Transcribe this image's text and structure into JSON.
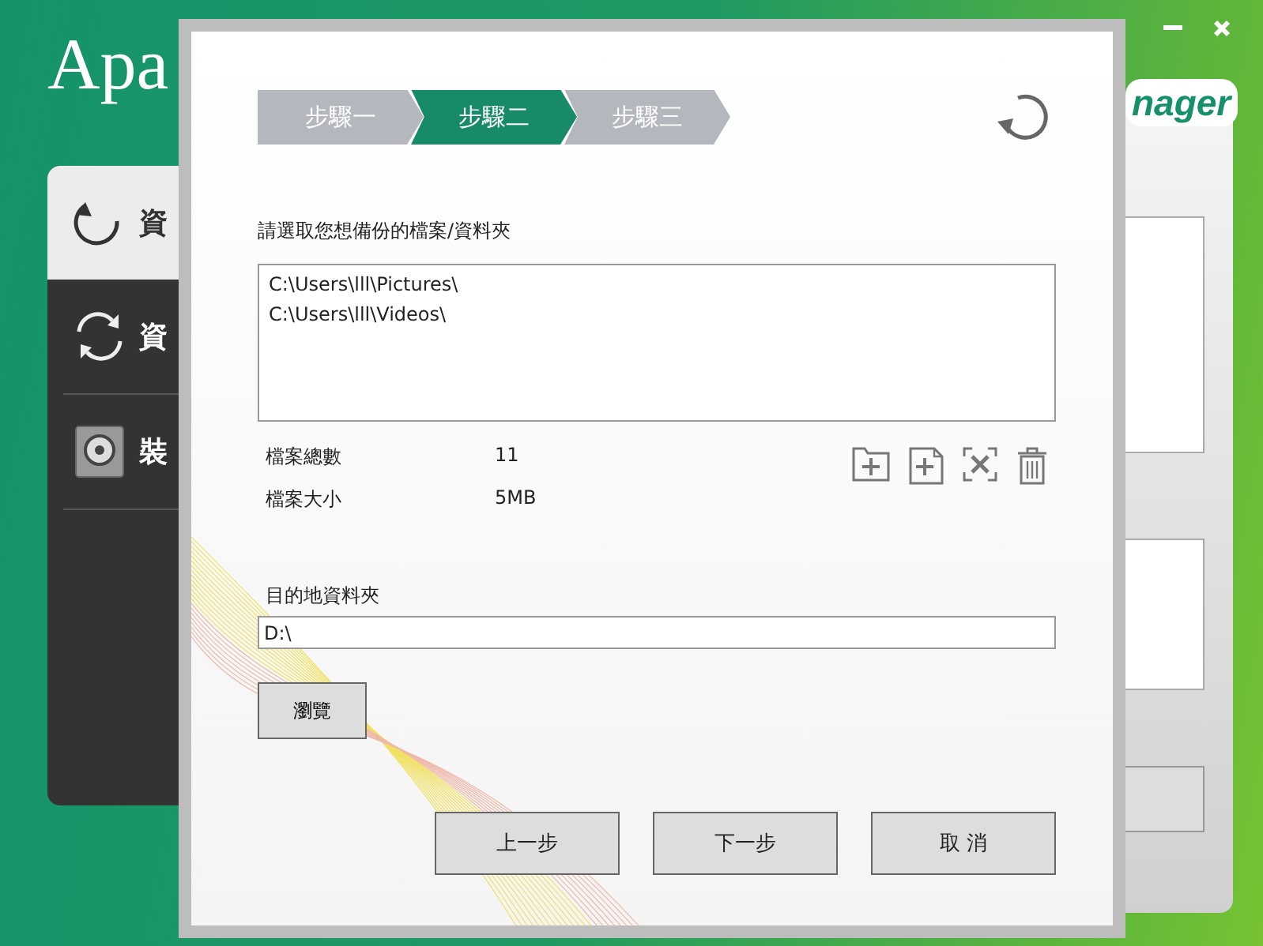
{
  "app": {
    "logo": "Apa",
    "logo_tail": "nager",
    "sidebar": [
      {
        "label": "資",
        "kind": "restore",
        "selected": true
      },
      {
        "label": "資",
        "kind": "sync",
        "selected": false
      },
      {
        "label": "裝",
        "kind": "drive",
        "selected": false
      }
    ]
  },
  "dialog": {
    "steps": [
      {
        "label": "步驟一",
        "selected": false
      },
      {
        "label": "步驟二",
        "selected": true
      },
      {
        "label": "步驟三",
        "selected": false
      }
    ],
    "prompt": "請選取您想備份的檔案/資料夾",
    "sources": [
      "C:\\Users\\lll\\Pictures\\",
      "C:\\Users\\lll\\Videos\\"
    ],
    "stats": [
      {
        "label": "檔案總數",
        "value": "11"
      },
      {
        "label": "檔案大小",
        "value": "5MB"
      }
    ],
    "destination": {
      "label": "目的地資料夾",
      "value": "D:\\"
    },
    "browse": "瀏覽",
    "buttons": [
      "上一步",
      "下一步",
      "取 消"
    ]
  }
}
